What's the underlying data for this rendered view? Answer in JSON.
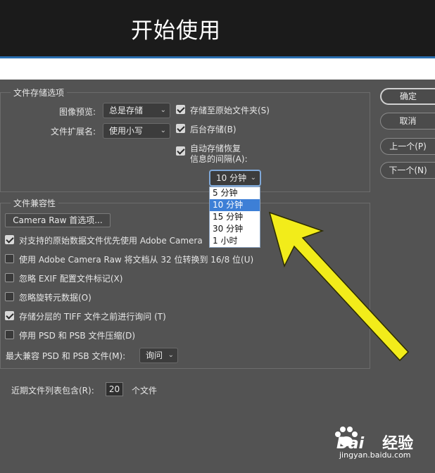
{
  "header": {
    "title": "开始使用"
  },
  "file_saving": {
    "legend": "文件存储选项",
    "image_preview_label": "图像预览:",
    "image_preview_value": "总是存储",
    "extension_label": "文件扩展名:",
    "extension_value": "使用小写",
    "save_original_label": "存储至原始文件夹(S)",
    "save_original_checked": true,
    "background_save_label": "后台存储(B)",
    "background_save_checked": true,
    "autosave_label_line1": "自动存储恢复",
    "autosave_label_line2": "信息的间隔(A):",
    "autosave_checked": true,
    "autosave_interval_value": "10 分钟",
    "autosave_options": [
      "5 分钟",
      "10 分钟",
      "15 分钟",
      "30 分钟",
      "1 小时"
    ],
    "autosave_selected_index": 1
  },
  "compat": {
    "legend": "文件兼容性",
    "camera_raw_prefs_button": "Camera Raw 首选项...",
    "options": [
      {
        "label": "对支持的原始数据文件优先使用 Adobe Camera",
        "checked": true
      },
      {
        "label": "使用 Adobe Camera Raw 将文档从 32 位转换到 16/8 位(U)",
        "checked": false
      },
      {
        "label": "忽略 EXIF 配置文件标记(X)",
        "checked": false
      },
      {
        "label": "忽略旋转元数据(O)",
        "checked": false
      },
      {
        "label": "存储分层的 TIFF 文件之前进行询问 (T)",
        "checked": true
      },
      {
        "label": "停用 PSD 和 PSB 文件压缩(D)",
        "checked": false
      }
    ],
    "max_compat_label": "最大兼容 PSD 和 PSB 文件(M):",
    "max_compat_value": "询问"
  },
  "recent": {
    "label": "近期文件列表包含(R):",
    "value": "20",
    "suffix": "个文件"
  },
  "buttons": {
    "ok": "确定",
    "cancel": "取消",
    "prev": "上一个(P)",
    "next": "下一个(N)"
  },
  "annotation": {
    "arrow_color": "#f2ec1a"
  },
  "watermark": {
    "brand": "Bai",
    "brand2": "经验",
    "url": "jingyan.baidu.com"
  },
  "colors": {
    "accent": "#3d7fd6",
    "dialog_bg": "#535353",
    "title_bar": "#1b1b1b"
  }
}
